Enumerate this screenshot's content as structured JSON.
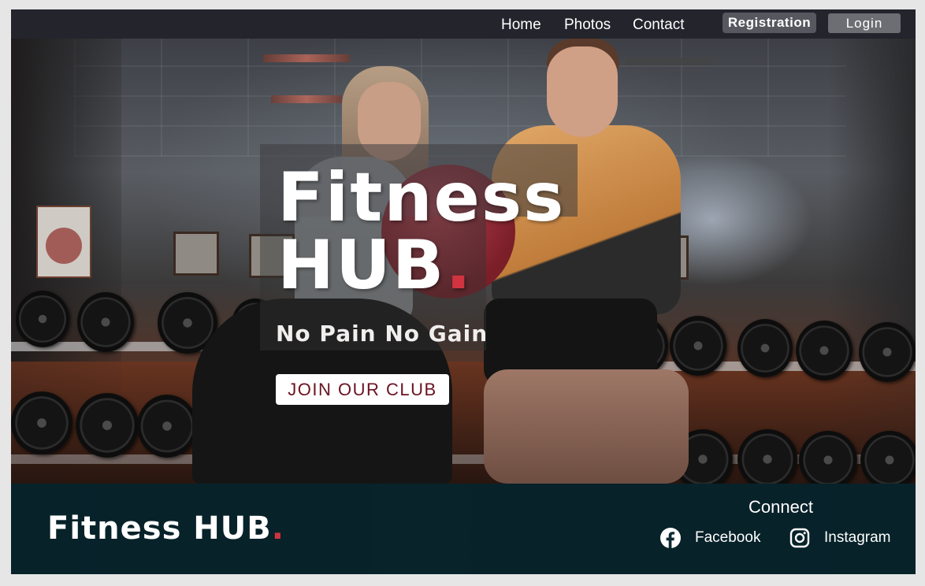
{
  "nav": {
    "links": [
      "Home",
      "Photos",
      "Contact"
    ],
    "registration_label": "Registration",
    "login_label": "Login"
  },
  "hero": {
    "title_line1": "Fitness",
    "title_line2": "HUB",
    "title_dot": ".",
    "tagline": "No Pain No Gain",
    "cta_label": "JOIN OUR CLUB"
  },
  "footer": {
    "logo_text": "Fitness HUB",
    "logo_dot": ".",
    "connect_heading": "Connect",
    "social": [
      {
        "label": "Facebook",
        "icon": "facebook-icon"
      },
      {
        "label": "Instagram",
        "icon": "instagram-icon"
      }
    ]
  },
  "colors": {
    "accent_red": "#d13340",
    "nav_bg": "#23242c",
    "footer_bg": "#0c2a33",
    "cta_text": "#6b1220"
  }
}
